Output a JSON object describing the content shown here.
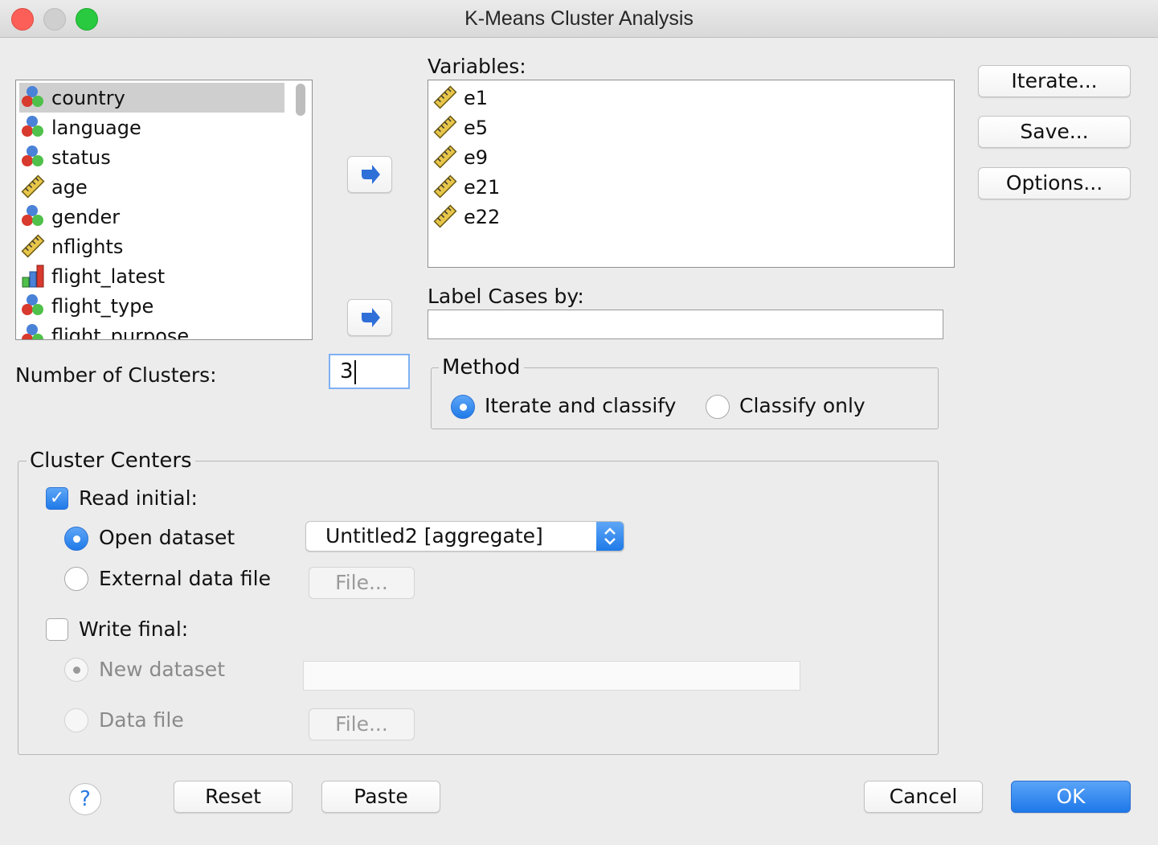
{
  "window": {
    "title": "K-Means Cluster Analysis"
  },
  "source_list": {
    "items": [
      {
        "label": "country",
        "icon": "nominal-icon",
        "selected": true
      },
      {
        "label": "language",
        "icon": "nominal-icon"
      },
      {
        "label": "status",
        "icon": "nominal-icon"
      },
      {
        "label": "age",
        "icon": "scale-ruler-icon"
      },
      {
        "label": "gender",
        "icon": "nominal-icon"
      },
      {
        "label": "nflights",
        "icon": "scale-ruler-icon"
      },
      {
        "label": "flight_latest",
        "icon": "ordinal-bars-icon"
      },
      {
        "label": "flight_type",
        "icon": "nominal-icon"
      },
      {
        "label": "flight_purpose",
        "icon": "nominal-icon"
      }
    ]
  },
  "variables": {
    "label": "Variables:",
    "items": [
      {
        "label": "e1",
        "icon": "scale-ruler-icon"
      },
      {
        "label": "e5",
        "icon": "scale-ruler-icon"
      },
      {
        "label": "e9",
        "icon": "scale-ruler-icon"
      },
      {
        "label": "e21",
        "icon": "scale-ruler-icon"
      },
      {
        "label": "e22",
        "icon": "scale-ruler-icon"
      }
    ]
  },
  "label_cases": {
    "label": "Label Cases by:",
    "value": ""
  },
  "side_buttons": {
    "iterate": "Iterate...",
    "save": "Save...",
    "options": "Options..."
  },
  "clusters": {
    "label": "Number of Clusters:",
    "value": "3"
  },
  "method": {
    "legend": "Method",
    "iterate_label": "Iterate and classify",
    "classify_label": "Classify only",
    "selected": "Iterate and classify"
  },
  "cluster_centers": {
    "legend": "Cluster Centers",
    "read_initial": {
      "label": "Read initial:",
      "checked": true
    },
    "open_dataset": {
      "label": "Open dataset",
      "selected": true
    },
    "dataset_select": {
      "value": "Untitled2 [aggregate]"
    },
    "external_file": {
      "label": "External data file",
      "button": "File..."
    },
    "write_final": {
      "label": "Write final:",
      "checked": false
    },
    "new_dataset": {
      "label": "New dataset",
      "value": ""
    },
    "data_file": {
      "label": "Data file",
      "button": "File..."
    }
  },
  "footer": {
    "help": "?",
    "reset": "Reset",
    "paste": "Paste",
    "cancel": "Cancel",
    "ok": "OK"
  },
  "colors": {
    "accent": "#1f7ae8",
    "close": "#fc5f57",
    "minimize": "#d0d0d0",
    "zoom": "#29c940"
  }
}
